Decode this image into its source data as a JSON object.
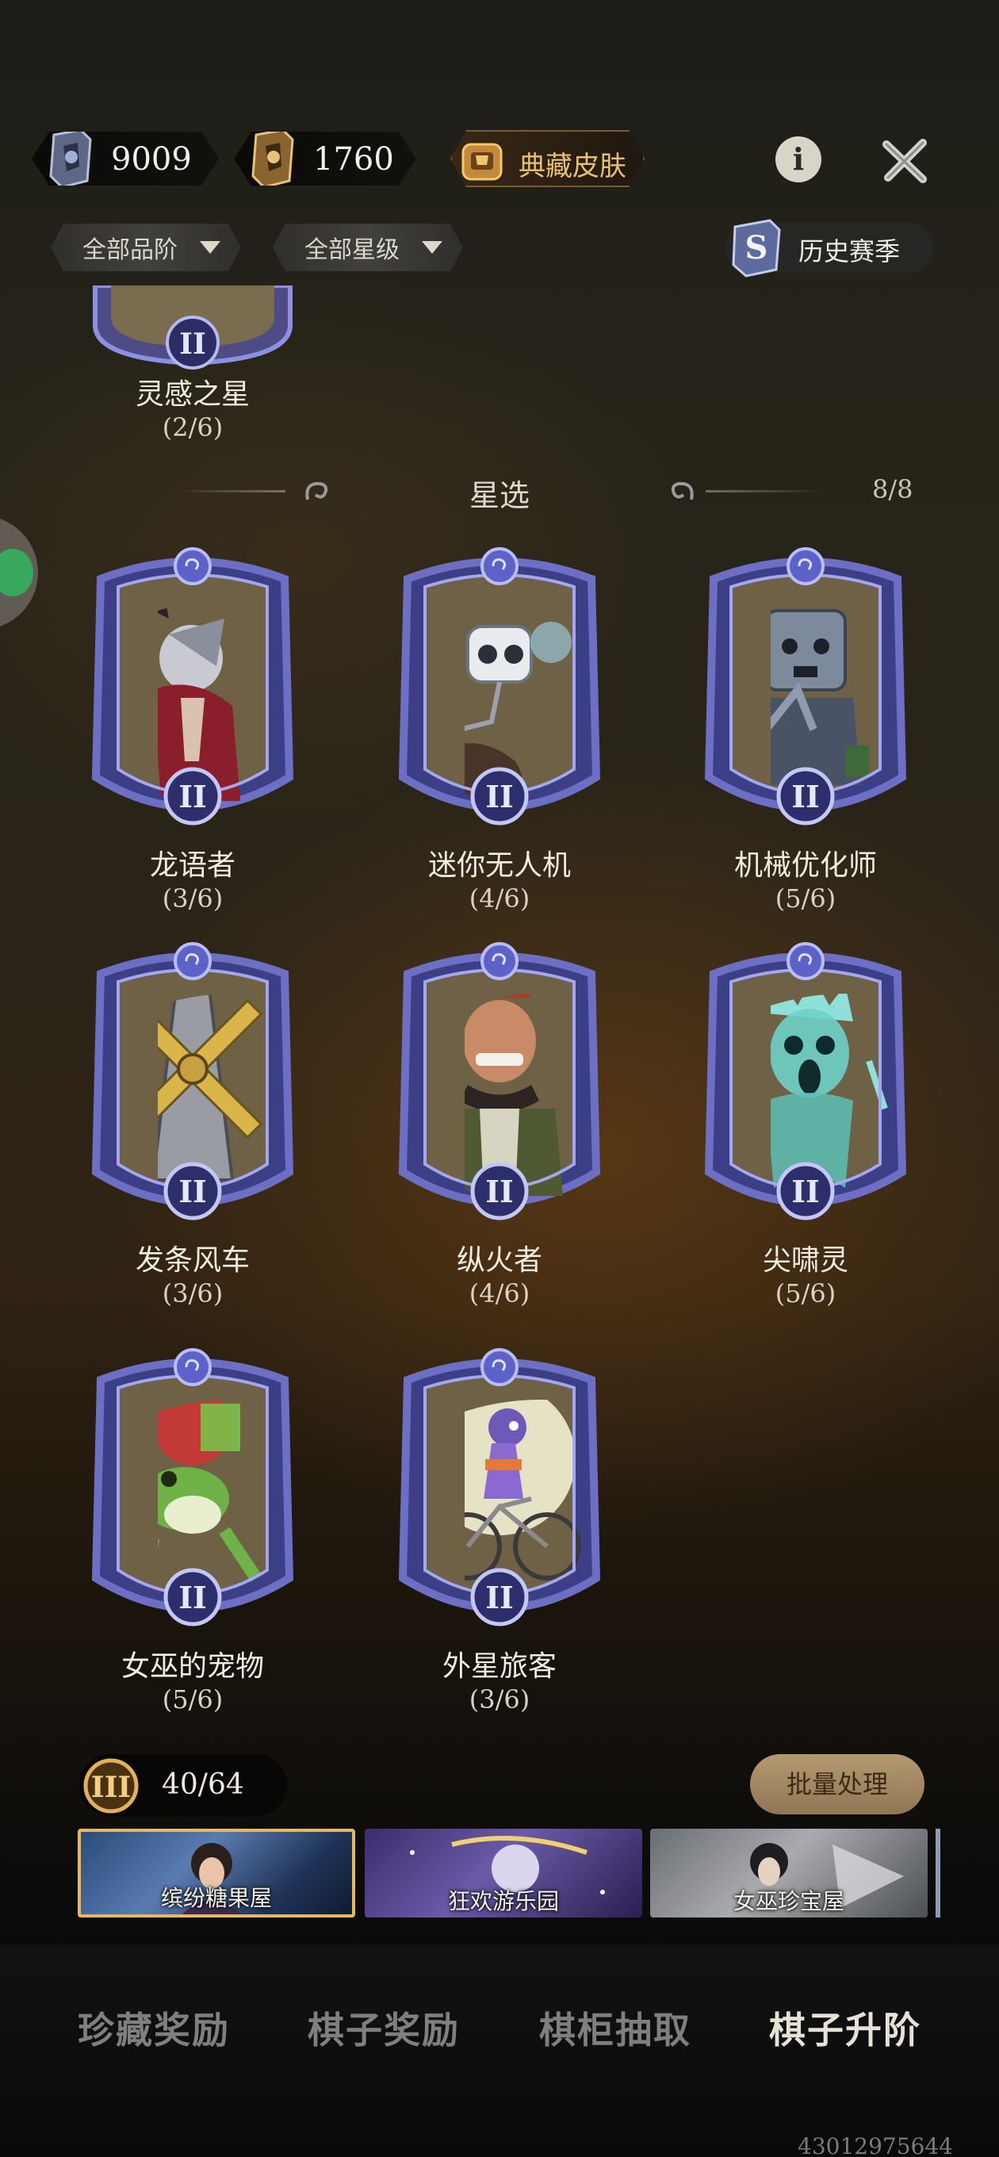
{
  "colors": {
    "frame_purple": "#6d6fc4",
    "frame_dark": "#3c3e86",
    "accent_gold": "#e7b85e",
    "batch_button": "#a68a62"
  },
  "topbar": {
    "silver_currency": {
      "icon": "silver-emblem-icon",
      "value": "9009"
    },
    "gold_currency": {
      "icon": "gold-emblem-icon",
      "value": "1760"
    },
    "collection_skin": {
      "icon": "treasure-chest-icon",
      "label": "典藏皮肤"
    },
    "info_icon": "info-icon",
    "info_glyph": "i",
    "close_icon": "close-icon"
  },
  "filters": {
    "quality": "全部品阶",
    "star": "全部星级",
    "history": {
      "icon": "season-s-icon",
      "letter": "S",
      "label": "历史赛季"
    }
  },
  "previous_item": {
    "name": "灵感之星",
    "progress": "(2/6)",
    "tier": "II"
  },
  "section": {
    "title": "星选",
    "count": "8/8"
  },
  "cards": [
    {
      "name": "龙语者",
      "progress": "(3/6)",
      "tier": "II",
      "art": "dragon-speaker"
    },
    {
      "name": "迷你无人机",
      "progress": "(4/6)",
      "tier": "II",
      "art": "mini-drone"
    },
    {
      "name": "机械优化师",
      "progress": "(5/6)",
      "tier": "II",
      "art": "mech-optimizer"
    },
    {
      "name": "发条风车",
      "progress": "(3/6)",
      "tier": "II",
      "art": "clockwork-windmill"
    },
    {
      "name": "纵火者",
      "progress": "(4/6)",
      "tier": "II",
      "art": "arsonist"
    },
    {
      "name": "尖啸灵",
      "progress": "(5/6)",
      "tier": "II",
      "art": "screaming-spirit"
    },
    {
      "name": "女巫的宠物",
      "progress": "(5/6)",
      "tier": "II",
      "art": "witch-pet-frog"
    },
    {
      "name": "外星旅客",
      "progress": "(3/6)",
      "tier": "II",
      "art": "alien-cyclist"
    }
  ],
  "tier_counter": {
    "badge": "III",
    "value": "40/64"
  },
  "batch_button": "批量处理",
  "skin_tabs": [
    {
      "label": "缤纷糖果屋",
      "active": true
    },
    {
      "label": "狂欢游乐园",
      "active": false
    },
    {
      "label": "女巫珍宝屋",
      "active": false
    }
  ],
  "bottom_nav": [
    {
      "label": "珍藏奖励",
      "active": false
    },
    {
      "label": "棋子奖励",
      "active": false
    },
    {
      "label": "棋柜抽取",
      "active": false
    },
    {
      "label": "棋子升阶",
      "active": true
    }
  ],
  "footer_id": "43012975644"
}
